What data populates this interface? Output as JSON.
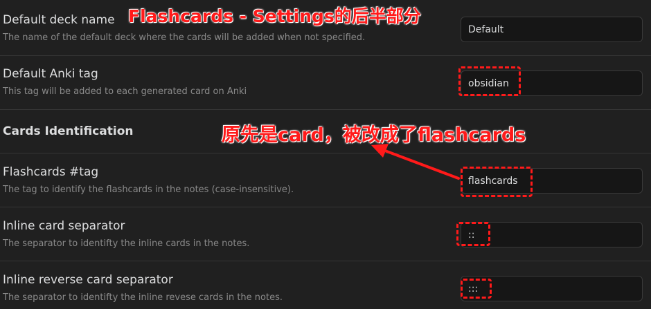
{
  "annotations": {
    "title": "Flashcards - Settings的后半部分",
    "note": "原先是card，被改成了flashcards",
    "color": "#ff1a1a"
  },
  "settings": {
    "default_deck": {
      "name": "Default deck name",
      "description": "The name of the default deck where the cards will be added when not specified.",
      "value": "Default"
    },
    "default_tag": {
      "name": "Default Anki tag",
      "description": "This tag will be added to each generated card on Anki",
      "value": "obsidian"
    },
    "section_heading": "Cards Identification",
    "flashcards_tag": {
      "name": "Flashcards #tag",
      "description": "The tag to identify the flashcards in the notes (case-insensitive).",
      "value": "flashcards"
    },
    "inline_separator": {
      "name": "Inline card separator",
      "description": "The separator to identifty the inline cards in the notes.",
      "value": "::"
    },
    "inline_reverse_separator": {
      "name": "Inline reverse card separator",
      "description": "The separator to identifty the inline revese cards in the notes.",
      "value": ":::"
    }
  }
}
